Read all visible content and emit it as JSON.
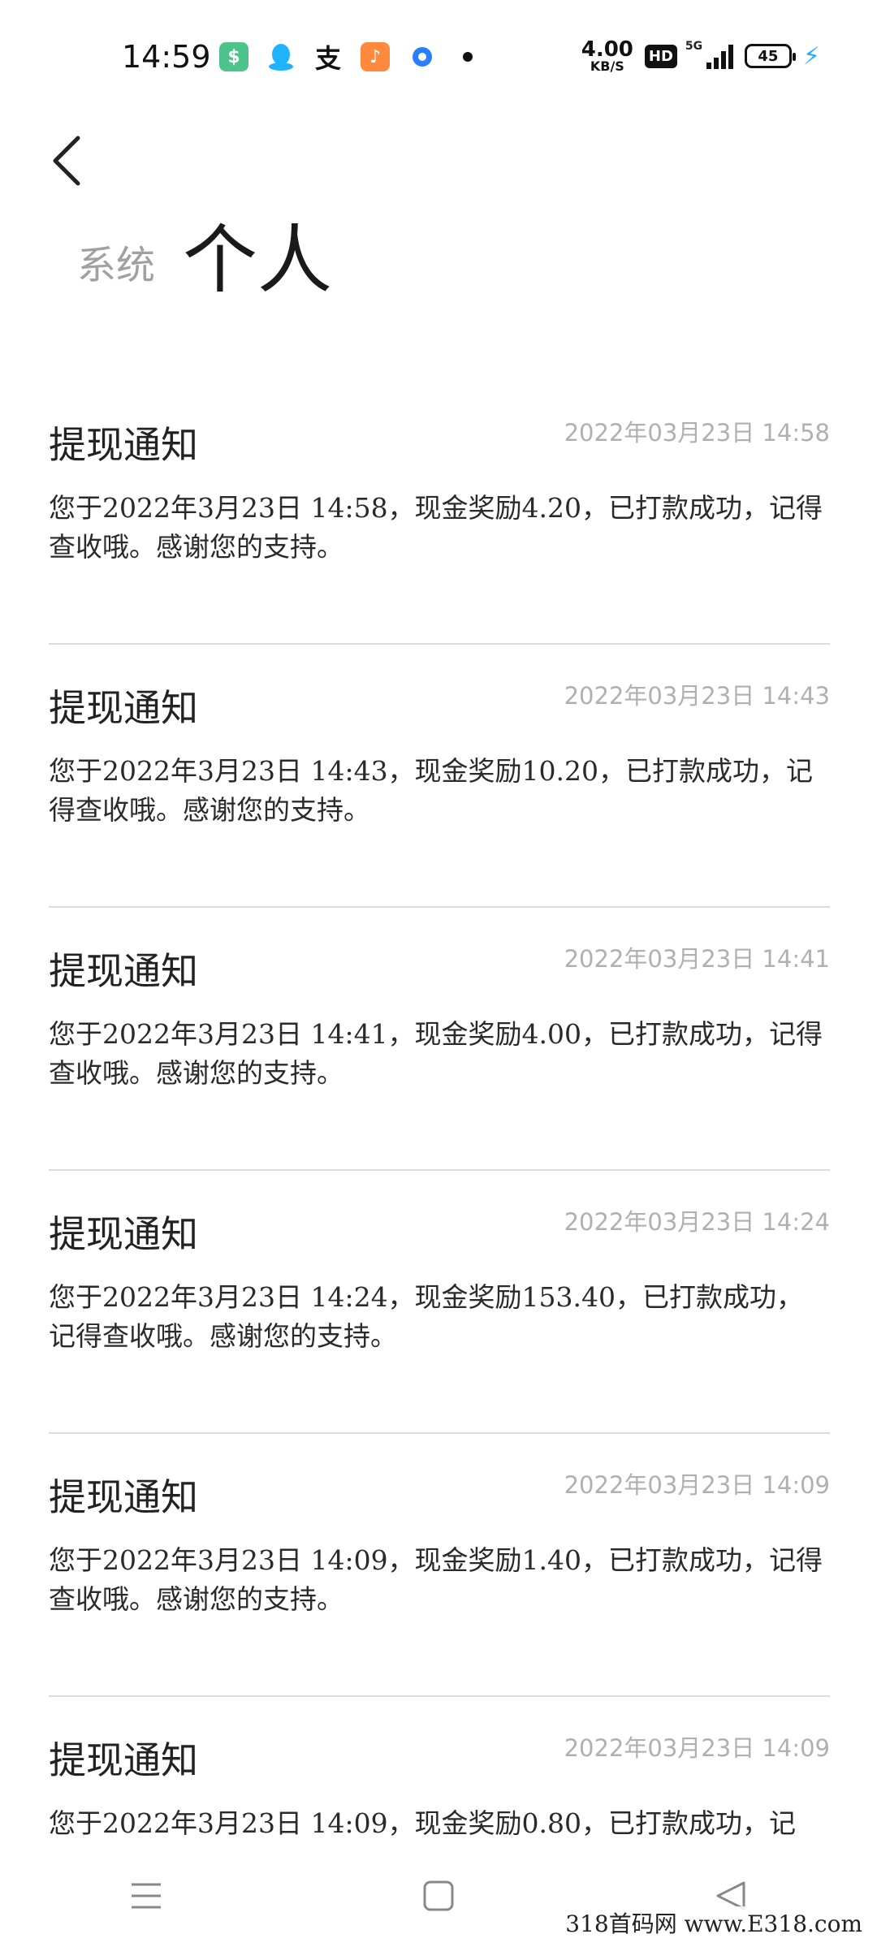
{
  "status_bar": {
    "time": "14:59",
    "net_speed_value": "4.00",
    "net_speed_unit": "KB/S",
    "hd_label": "HD",
    "network_label": "5G",
    "battery_level": "45",
    "app_icons": [
      "shield-app-icon",
      "qq-icon",
      "alipay-icon",
      "music-app-icon",
      "browser-app-icon"
    ]
  },
  "tabs": {
    "system": "系统",
    "personal": "个人"
  },
  "notifications": [
    {
      "title": "提现通知",
      "time": "2022年03月23日 14:58",
      "body": "您于2022年3月23日 14:58，现金奖励4.20，已打款成功，记得查收哦。感谢您的支持。"
    },
    {
      "title": "提现通知",
      "time": "2022年03月23日 14:43",
      "body": "您于2022年3月23日 14:43，现金奖励10.20，已打款成功，记得查收哦。感谢您的支持。"
    },
    {
      "title": "提现通知",
      "time": "2022年03月23日 14:41",
      "body": "您于2022年3月23日 14:41，现金奖励4.00，已打款成功，记得查收哦。感谢您的支持。"
    },
    {
      "title": "提现通知",
      "time": "2022年03月23日 14:24",
      "body": "您于2022年3月23日 14:24，现金奖励153.40，已打款成功，记得查收哦。感谢您的支持。"
    },
    {
      "title": "提现通知",
      "time": "2022年03月23日 14:09",
      "body": "您于2022年3月23日 14:09，现金奖励1.40，已打款成功，记得查收哦。感谢您的支持。"
    },
    {
      "title": "提现通知",
      "time": "2022年03月23日 14:09",
      "body": "您于2022年3月23日 14:09，现金奖励0.80，已打款成功，记"
    }
  ],
  "watermark": "318首码网 www.E318.com",
  "colors": {
    "charge": "#2aa7ff",
    "muted": "#b0b0b0",
    "divider": "#dcdcdc"
  }
}
